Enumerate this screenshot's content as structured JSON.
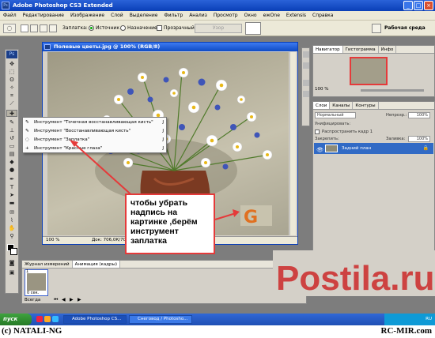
{
  "window": {
    "title": "Adobe Photoshop CS3 Extended",
    "app_icon": "Ps"
  },
  "menu": [
    "Файл",
    "Редактирование",
    "Изображение",
    "Слой",
    "Выделение",
    "Фильтр",
    "Анализ",
    "Просмотр",
    "Окно",
    "ежOne",
    "Extensis",
    "Справка"
  ],
  "options_bar": {
    "patch_label": "Заплатка:",
    "source_label": "Источник",
    "destination_label": "Назначение",
    "transparent_label": "Прозрачный",
    "pattern_button": "Узор",
    "workspace_label": "Рабочая среда"
  },
  "document": {
    "title": "Полевые цветы.jpg @ 100% (RGB/8)",
    "zoom": "100 %",
    "doc_info": "Док: 706,0К/706,0К"
  },
  "flyout": {
    "items": [
      {
        "label": "Инструмент \"Точечная восстанавливающая кисть\"",
        "key": "J"
      },
      {
        "label": "Инструмент \"Восстанавливающая кисть\"",
        "key": "J"
      },
      {
        "label": "Инструмент \"Заплатка\"",
        "key": "J"
      },
      {
        "label": "Инструмент \"Красные глаза\"",
        "key": "J"
      }
    ]
  },
  "callout": {
    "text": "чтобы убрать надпись на картинке ,берём инструмент заплатка"
  },
  "navigator_panel": {
    "tabs": [
      "Навигатор",
      "Гистограмма",
      "Инфо"
    ],
    "zoom": "100 %"
  },
  "layers_panel": {
    "tabs": [
      "Слои",
      "Каналы",
      "Контуры"
    ],
    "blend_mode": "Нормальный",
    "opacity_label": "Непрозр.:",
    "opacity_value": "100%",
    "unify_label": "Унифицировать:",
    "propagate_label": "Распространить кадр 1",
    "lock_label": "Закрепить:",
    "fill_label": "Заливка:",
    "fill_value": "100%",
    "layer_name": "Задний план"
  },
  "animation_panel": {
    "tabs": [
      "Журнал измерений",
      "Анимация (кадры)"
    ],
    "frame_number": "1",
    "frame_time": "0 сек.",
    "loop": "Всегда"
  },
  "taskbar": {
    "start": "пуск",
    "items": [
      "Adobe Photoshop CS...",
      "Снеговод / Photosho..."
    ],
    "tray_text": "RU"
  },
  "watermark": {
    "left": "(c) NATALI-NG",
    "right": "RC-MIR.com",
    "canvas_mark": "G",
    "postila": "Postila.ru"
  },
  "colors": {
    "title_blue": "#0a3fb7",
    "callout_border": "#e53a3a",
    "postila_red": "#cc2a2a",
    "selection_blue": "#316ac5"
  }
}
